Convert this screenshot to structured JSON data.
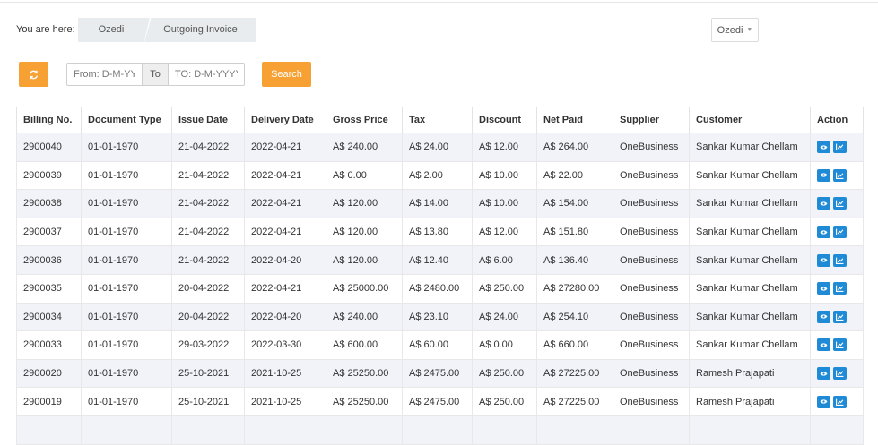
{
  "breadcrumb": {
    "label": "You are here:",
    "items": [
      "Ozedi",
      "Outgoing Invoice"
    ]
  },
  "company_select": {
    "value": "Ozedi"
  },
  "filters": {
    "from_placeholder": "From: D-M-YYYY",
    "to_label": "To",
    "to_placeholder": "TO: D-M-YYYY",
    "search_label": "Search"
  },
  "colors": {
    "accent": "#f7a135",
    "action": "#1f8bd6",
    "row_stripe": "#f1f3f8"
  },
  "table": {
    "headers": [
      "Billing No.",
      "Document Type",
      "Issue Date",
      "Delivery Date",
      "Gross Price",
      "Tax",
      "Discount",
      "Net Paid",
      "Supplier",
      "Customer",
      "Action"
    ],
    "rows": [
      [
        "2900040",
        "01-01-1970",
        "21-04-2022",
        "2022-04-21",
        "A$ 240.00",
        "A$ 24.00",
        "A$ 12.00",
        "A$ 264.00",
        "OneBusiness",
        "Sankar Kumar Chellam"
      ],
      [
        "2900039",
        "01-01-1970",
        "21-04-2022",
        "2022-04-21",
        "A$ 0.00",
        "A$ 2.00",
        "A$ 10.00",
        "A$ 22.00",
        "OneBusiness",
        "Sankar Kumar Chellam"
      ],
      [
        "2900038",
        "01-01-1970",
        "21-04-2022",
        "2022-04-21",
        "A$ 120.00",
        "A$ 14.00",
        "A$ 10.00",
        "A$ 154.00",
        "OneBusiness",
        "Sankar Kumar Chellam"
      ],
      [
        "2900037",
        "01-01-1970",
        "21-04-2022",
        "2022-04-21",
        "A$ 120.00",
        "A$ 13.80",
        "A$ 12.00",
        "A$ 151.80",
        "OneBusiness",
        "Sankar Kumar Chellam"
      ],
      [
        "2900036",
        "01-01-1970",
        "21-04-2022",
        "2022-04-20",
        "A$ 120.00",
        "A$ 12.40",
        "A$ 6.00",
        "A$ 136.40",
        "OneBusiness",
        "Sankar Kumar Chellam"
      ],
      [
        "2900035",
        "01-01-1970",
        "20-04-2022",
        "2022-04-21",
        "A$ 25000.00",
        "A$ 2480.00",
        "A$ 250.00",
        "A$ 27280.00",
        "OneBusiness",
        "Sankar Kumar Chellam"
      ],
      [
        "2900034",
        "01-01-1970",
        "20-04-2022",
        "2022-04-20",
        "A$ 240.00",
        "A$ 23.10",
        "A$ 24.00",
        "A$ 254.10",
        "OneBusiness",
        "Sankar Kumar Chellam"
      ],
      [
        "2900033",
        "01-01-1970",
        "29-03-2022",
        "2022-03-30",
        "A$ 600.00",
        "A$ 60.00",
        "A$ 0.00",
        "A$ 660.00",
        "OneBusiness",
        "Sankar Kumar Chellam"
      ],
      [
        "2900020",
        "01-01-1970",
        "25-10-2021",
        "2021-10-25",
        "A$ 25250.00",
        "A$ 2475.00",
        "A$ 250.00",
        "A$ 27225.00",
        "OneBusiness",
        "Ramesh Prajapati"
      ],
      [
        "2900019",
        "01-01-1970",
        "25-10-2021",
        "2021-10-25",
        "A$ 25250.00",
        "A$ 2475.00",
        "A$ 250.00",
        "A$ 27225.00",
        "OneBusiness",
        "Ramesh Prajapati"
      ],
      [
        "",
        "",
        "",
        "",
        "",
        "",
        "",
        "",
        "",
        ""
      ]
    ],
    "action_icons": [
      "eye-icon",
      "chart-icon"
    ]
  }
}
